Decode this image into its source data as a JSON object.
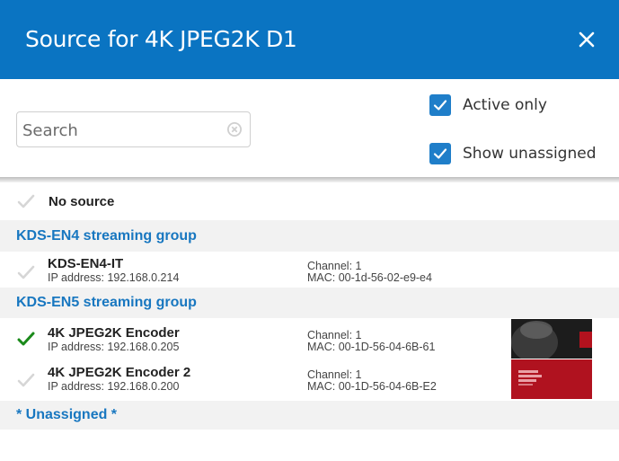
{
  "dialog": {
    "title": "Source for 4K JPEG2K D1",
    "close_glyph": "✕"
  },
  "filters": {
    "search_placeholder": "Search",
    "active_only_label": "Active only",
    "active_only_checked": true,
    "show_unassigned_label": "Show unassigned",
    "show_unassigned_checked": true
  },
  "list": {
    "no_source_label": "No source",
    "groups": [
      {
        "name": "KDS-EN4 streaming group",
        "devices": [
          {
            "name": "KDS-EN4-IT",
            "ip": "IP address: 192.168.0.214",
            "channel": "Channel: 1",
            "mac": "MAC: 00-1d-56-02-e9-e4",
            "selected": false,
            "has_thumbnail": false
          }
        ]
      },
      {
        "name": "KDS-EN5 streaming group",
        "devices": [
          {
            "name": "4K JPEG2K Encoder",
            "ip": "IP address: 192.168.0.205",
            "channel": "Channel: 1",
            "mac": "MAC: 00-1D-56-04-6B-61",
            "selected": true,
            "has_thumbnail": true
          },
          {
            "name": "4K JPEG2K Encoder 2",
            "ip": "IP address: 192.168.0.200",
            "channel": "Channel: 1",
            "mac": "MAC: 00-1D-56-04-6B-E2",
            "selected": false,
            "has_thumbnail": true
          }
        ]
      }
    ],
    "unassigned_label": "* Unassigned *"
  },
  "colors": {
    "titlebar": "#0a74c2",
    "checkbox": "#1f7ec9",
    "group_text": "#1877c0",
    "selected_tick": "#1a8a1a",
    "unselected_tick": "#d6d6d6"
  }
}
